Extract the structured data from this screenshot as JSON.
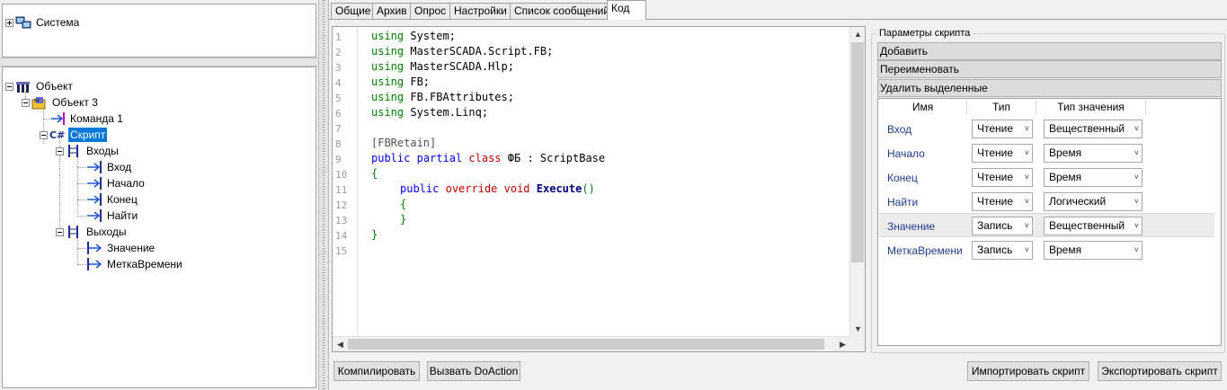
{
  "tree_system": {
    "label": "Система"
  },
  "tree_object": {
    "root": "Объект",
    "object3": "Объект 3",
    "command1": "Команда 1",
    "script": "Скрипт",
    "inputs": "Входы",
    "input_items": [
      "Вход",
      "Начало",
      "Конец",
      "Найти"
    ],
    "outputs": "Выходы",
    "output_items": [
      "Значение",
      "МеткаВремени"
    ]
  },
  "tabs": [
    "Общие",
    "Архив",
    "Опрос",
    "Настройки",
    "Список сообщений",
    "Код"
  ],
  "editor": {
    "line_numbers": [
      "1",
      "2",
      "3",
      "4",
      "5",
      "6",
      "7",
      "8",
      "9",
      "10",
      "11",
      "12",
      "13",
      "14",
      "15"
    ],
    "using_kw": "using",
    "usings": [
      "System;",
      "MasterSCADA.Script.FB;",
      "MasterSCADA.Hlp;",
      "FB;",
      "FB.FBAttributes;",
      "System.Linq;"
    ],
    "attribute": "[FBRetain]",
    "class_public": "public",
    "class_partial": "partial",
    "class_class": "class",
    "class_rest": "ФБ : ScriptBase",
    "open_brace": "{",
    "method_public": "public",
    "method_override": "override",
    "method_void": "void",
    "method_name": "Execute",
    "method_parens": "()",
    "method_open": "{",
    "method_close": "}",
    "close_brace": "}"
  },
  "params": {
    "title": "Параметры скрипта",
    "add": "Добавить",
    "rename": "Переименовать",
    "delete_selected": "Удалить выделенные",
    "col_name": "Имя",
    "col_type": "Тип",
    "col_value_type": "Тип значения",
    "rows": [
      {
        "name": "Вход",
        "type": "Чтение",
        "value_type": "Вещественный"
      },
      {
        "name": "Начало",
        "type": "Чтение",
        "value_type": "Время"
      },
      {
        "name": "Конец",
        "type": "Чтение",
        "value_type": "Время"
      },
      {
        "name": "Найти",
        "type": "Чтение",
        "value_type": "Логический"
      },
      {
        "name": "Значение",
        "type": "Запись",
        "value_type": "Вещественный"
      },
      {
        "name": "МеткаВремени",
        "type": "Запись",
        "value_type": "Время"
      }
    ]
  },
  "buttons": {
    "compile": "Компилировать",
    "call_doaction": "Вызвать DoAction",
    "import": "Импортировать скрипт",
    "export": "Экспортировать скрипт"
  }
}
